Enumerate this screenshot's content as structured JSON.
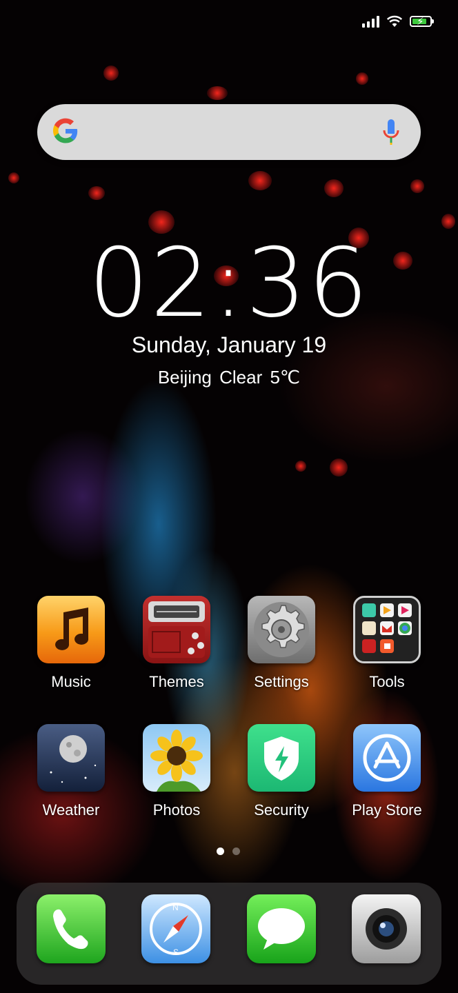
{
  "status_bar": {
    "signal": "signal-bars-icon",
    "wifi": "wifi-icon",
    "battery": "battery-charging-icon",
    "battery_level": 0.85
  },
  "search": {
    "logo": "google-logo-icon",
    "mic": "microphone-icon",
    "placeholder": ""
  },
  "clock_widget": {
    "time": "02:36",
    "date": "Sunday, January 19",
    "weather": "Beijing  Clear  5℃"
  },
  "apps": [
    {
      "label": "Music",
      "icon": "music-icon"
    },
    {
      "label": "Themes",
      "icon": "themes-icon"
    },
    {
      "label": "Settings",
      "icon": "settings-gear-icon"
    },
    {
      "label": "Tools",
      "icon": "tools-folder-icon"
    },
    {
      "label": "Weather",
      "icon": "weather-moon-icon"
    },
    {
      "label": "Photos",
      "icon": "photos-sunflower-icon"
    },
    {
      "label": "Security",
      "icon": "security-shield-icon"
    },
    {
      "label": "Play Store",
      "icon": "app-store-icon"
    }
  ],
  "page_indicator": {
    "current": 1,
    "total": 2
  },
  "dock": [
    {
      "name": "phone",
      "icon": "phone-icon"
    },
    {
      "name": "browser",
      "icon": "compass-icon"
    },
    {
      "name": "messages",
      "icon": "message-bubble-icon"
    },
    {
      "name": "camera",
      "icon": "camera-icon"
    }
  ],
  "colors": {
    "accent_green": "#2fd06f",
    "battery_green": "#3ec93e",
    "google_blue": "#4285F4",
    "google_red": "#EA4335",
    "google_yellow": "#FBBC05",
    "google_green": "#34A853"
  }
}
